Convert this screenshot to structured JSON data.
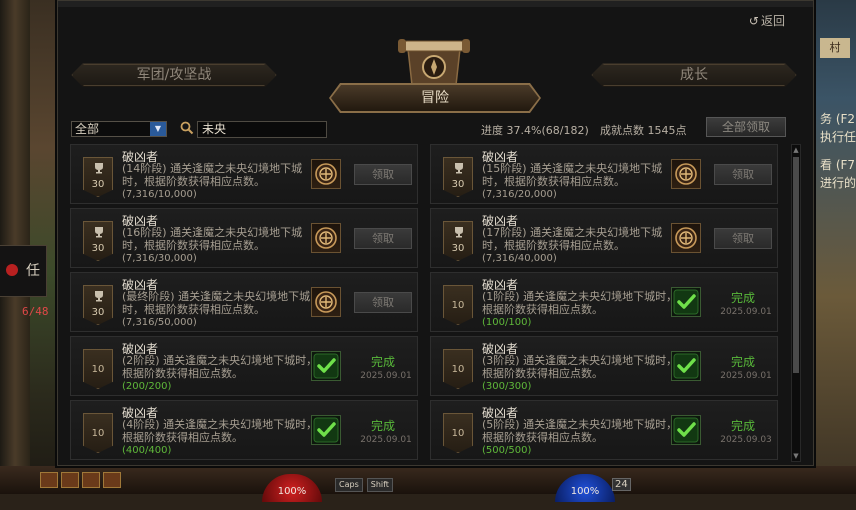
{
  "window": {
    "back_label": "返回",
    "tabs": {
      "left": "军团/攻坚战",
      "main": "冒险",
      "right": "成长"
    }
  },
  "filters": {
    "category_value": "全部",
    "search_value": "未央"
  },
  "summary": {
    "progress_label": "进度",
    "progress_percent": "37.4%",
    "progress_count": "(68/182)",
    "points_label": "成就点数",
    "points_value": "1545点",
    "claim_all_label": "全部领取"
  },
  "achievements": [
    {
      "title": "破凶者",
      "desc": "(14阶段) 通关逢魔之未央幻境地下城时，根据阶数获得相应点数。",
      "progress": "(7,316/10,000)",
      "points": "30",
      "status": "claimable",
      "button": "领取",
      "date": ""
    },
    {
      "title": "破凶者",
      "desc": "(15阶段) 通关逢魔之未央幻境地下城时，根据阶数获得相应点数。",
      "progress": "(7,316/20,000)",
      "points": "30",
      "status": "claimable",
      "button": "领取",
      "date": ""
    },
    {
      "title": "破凶者",
      "desc": "(16阶段) 通关逢魔之未央幻境地下城时，根据阶数获得相应点数。",
      "progress": "(7,316/30,000)",
      "points": "30",
      "status": "claimable",
      "button": "领取",
      "date": ""
    },
    {
      "title": "破凶者",
      "desc": "(17阶段) 通关逢魔之未央幻境地下城时，根据阶数获得相应点数。",
      "progress": "(7,316/40,000)",
      "points": "30",
      "status": "claimable",
      "button": "领取",
      "date": ""
    },
    {
      "title": "破凶者",
      "desc": "(最终阶段) 通关逢魔之未央幻境地下城时，根据阶数获得相应点数。",
      "progress": "(7,316/50,000)",
      "points": "30",
      "status": "claimable",
      "button": "领取",
      "date": ""
    },
    {
      "title": "破凶者",
      "desc": "(1阶段) 通关逢魔之未央幻境地下城时，根据阶数获得相应点数。",
      "progress": "(100/100)",
      "points": "10",
      "status": "done",
      "button": "完成",
      "date": "2025.09.01"
    },
    {
      "title": "破凶者",
      "desc": "(2阶段) 通关逢魔之未央幻境地下城时，根据阶数获得相应点数。",
      "progress": "(200/200)",
      "points": "10",
      "status": "done",
      "button": "完成",
      "date": "2025.09.01"
    },
    {
      "title": "破凶者",
      "desc": "(3阶段) 通关逢魔之未央幻境地下城时，根据阶数获得相应点数。",
      "progress": "(300/300)",
      "points": "10",
      "status": "done",
      "button": "完成",
      "date": "2025.09.01"
    },
    {
      "title": "破凶者",
      "desc": "(4阶段) 通关逢魔之未央幻境地下城时，根据阶数获得相应点数。",
      "progress": "(400/400)",
      "points": "10",
      "status": "done",
      "button": "完成",
      "date": "2025.09.01"
    },
    {
      "title": "破凶者",
      "desc": "(5阶段) 通关逢魔之未央幻境地下城时，根据阶数获得相应点数。",
      "progress": "(500/500)",
      "points": "10",
      "status": "done",
      "button": "完成",
      "date": "2025.09.03"
    }
  ],
  "background": {
    "side_tab_char": "任",
    "side_count": "6/48",
    "right_sign": "村",
    "right_lines": [
      "务 (F2)",
      "执行任",
      "看 (F7)",
      "进行的"
    ],
    "hud_hp": "100%",
    "hud_mp": "100%",
    "hud_keys": [
      "Caps",
      "Shift"
    ],
    "hud_num": "24"
  },
  "colors": {
    "done_green": "#58b83a",
    "gold_border": "#8a6e48"
  }
}
